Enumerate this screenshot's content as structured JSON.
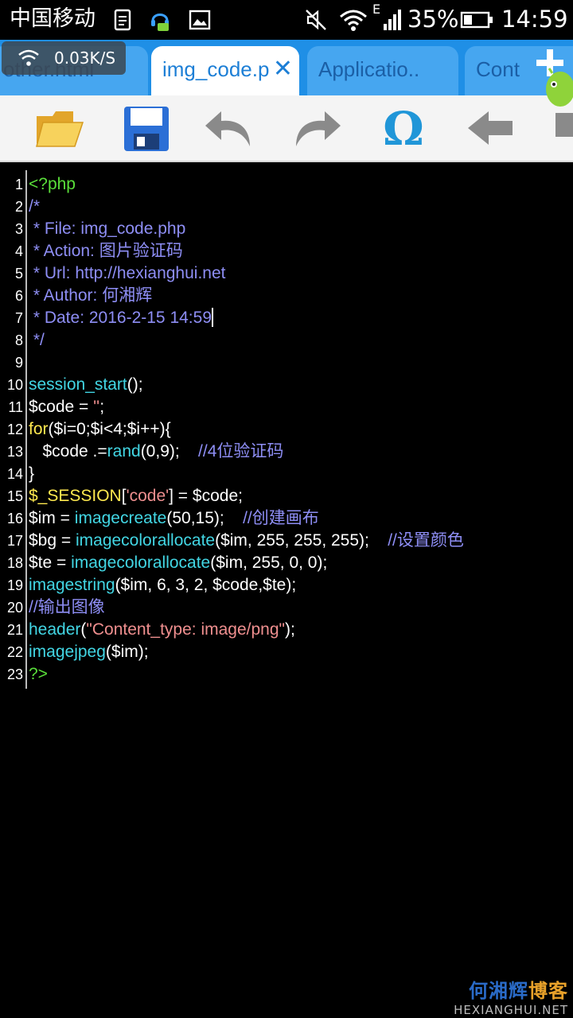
{
  "status_bar": {
    "carrier": "中国移动",
    "network_type": "E",
    "battery_percent": "35%",
    "battery_level": 0.35,
    "time": "14:59"
  },
  "net_speed": "0.03K/S",
  "tabs": [
    {
      "label": "other.html",
      "active": false
    },
    {
      "label": "img_code.p",
      "active": true
    },
    {
      "label": "Applicatio..",
      "active": false
    },
    {
      "label": "Cont",
      "active": false
    }
  ],
  "toolbar_icons": [
    "open-folder-icon",
    "save-icon",
    "undo-icon",
    "redo-icon",
    "omega-symbol-icon",
    "back-arrow-icon"
  ],
  "colors": {
    "tab_bar": "#1f8fe6",
    "php_tag": "#5adf3a",
    "comment": "#8e8ef5",
    "function": "#42d6e4",
    "keyword": "#ffe94f",
    "string": "#ef8f8f"
  },
  "code_lines": [
    {
      "n": "1",
      "tokens": [
        {
          "t": "<?php",
          "c": "tag"
        }
      ]
    },
    {
      "n": "2",
      "tokens": [
        {
          "t": "/*",
          "c": "comment"
        }
      ]
    },
    {
      "n": "3",
      "tokens": [
        {
          "t": " * File: img_code.php",
          "c": "comment"
        }
      ]
    },
    {
      "n": "4",
      "tokens": [
        {
          "t": " * Action: 图片验证码",
          "c": "comment"
        }
      ]
    },
    {
      "n": "5",
      "tokens": [
        {
          "t": " * Url: http://hexianghui.net",
          "c": "comment"
        }
      ]
    },
    {
      "n": "6",
      "tokens": [
        {
          "t": " * Author: 何湘辉",
          "c": "comment"
        }
      ]
    },
    {
      "n": "7",
      "tokens": [
        {
          "t": " * Date: 2016-2-15 14:59",
          "c": "comment"
        }
      ],
      "cursor": true
    },
    {
      "n": "8",
      "tokens": [
        {
          "t": " */",
          "c": "comment"
        }
      ]
    },
    {
      "n": "9",
      "tokens": []
    },
    {
      "n": "10",
      "tokens": [
        {
          "t": "session_start",
          "c": "fn"
        },
        {
          "t": "();",
          "c": "plain"
        }
      ]
    },
    {
      "n": "11",
      "tokens": [
        {
          "t": "$code = ",
          "c": "var"
        },
        {
          "t": "''",
          "c": "str"
        },
        {
          "t": ";",
          "c": "plain"
        }
      ]
    },
    {
      "n": "12",
      "tokens": [
        {
          "t": "for",
          "c": "kw"
        },
        {
          "t": "($i=0;$i<4;$i++){",
          "c": "plain"
        }
      ]
    },
    {
      "n": "13",
      "tokens": [
        {
          "t": "   $code .=",
          "c": "var"
        },
        {
          "t": "rand",
          "c": "fn"
        },
        {
          "t": "(0,9);    ",
          "c": "plain"
        },
        {
          "t": "//4位验证码",
          "c": "comment"
        }
      ]
    },
    {
      "n": "14",
      "tokens": [
        {
          "t": "}",
          "c": "plain"
        }
      ]
    },
    {
      "n": "15",
      "tokens": [
        {
          "t": "$_SESSION",
          "c": "kw"
        },
        {
          "t": "[",
          "c": "plain"
        },
        {
          "t": "'code'",
          "c": "str"
        },
        {
          "t": "] = $code;",
          "c": "plain"
        }
      ]
    },
    {
      "n": "16",
      "tokens": [
        {
          "t": "$im = ",
          "c": "var"
        },
        {
          "t": "imagecreate",
          "c": "fn"
        },
        {
          "t": "(50,15);    ",
          "c": "plain"
        },
        {
          "t": "//创建画布",
          "c": "comment"
        }
      ]
    },
    {
      "n": "17",
      "tokens": [
        {
          "t": "$bg = ",
          "c": "var"
        },
        {
          "t": "imagecolorallocate",
          "c": "fn"
        },
        {
          "t": "($im, 255, 255, 255);    ",
          "c": "plain"
        },
        {
          "t": "//设置颜色",
          "c": "comment"
        }
      ]
    },
    {
      "n": "18",
      "tokens": [
        {
          "t": "$te = ",
          "c": "var"
        },
        {
          "t": "imagecolorallocate",
          "c": "fn"
        },
        {
          "t": "($im, 255, 0, 0);",
          "c": "plain"
        }
      ]
    },
    {
      "n": "19",
      "tokens": [
        {
          "t": "imagestring",
          "c": "fn"
        },
        {
          "t": "($im, 6, 3, 2, $code,$te);",
          "c": "plain"
        }
      ]
    },
    {
      "n": "20",
      "tokens": [
        {
          "t": "//输出图像",
          "c": "comment"
        }
      ]
    },
    {
      "n": "21",
      "tokens": [
        {
          "t": "header",
          "c": "fn"
        },
        {
          "t": "(",
          "c": "plain"
        },
        {
          "t": "\"Content_type: image/png\"",
          "c": "str"
        },
        {
          "t": ");",
          "c": "plain"
        }
      ]
    },
    {
      "n": "22",
      "tokens": [
        {
          "t": "imagejpeg",
          "c": "fn"
        },
        {
          "t": "($im);",
          "c": "plain"
        }
      ]
    },
    {
      "n": "23",
      "tokens": [
        {
          "t": "?>",
          "c": "tag"
        }
      ]
    }
  ],
  "watermark": {
    "title_a": "何湘辉",
    "title_b": "博客",
    "site": "HEXIANGHUI.NET"
  }
}
